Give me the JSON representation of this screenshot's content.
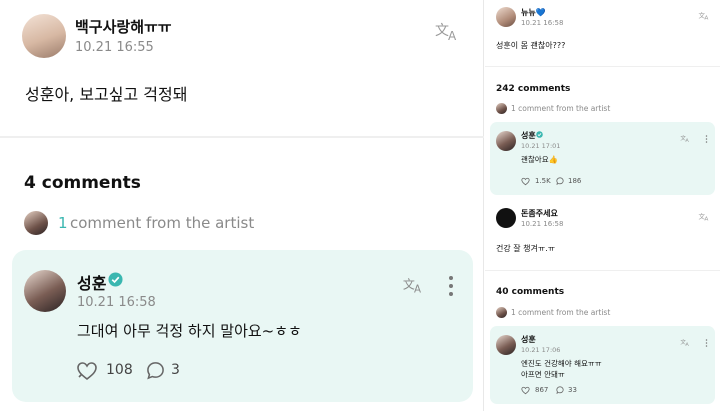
{
  "left": {
    "post": {
      "username": "백구사랑해ㅠㅠ",
      "time": "10.21 16:55",
      "body": "성훈아, 보고싶고 걱정돼"
    },
    "comments_title": "4 comments",
    "artist_count": "1",
    "artist_label": "comment from the artist",
    "comment": {
      "name": "성훈",
      "time": "10.21 16:58",
      "text": "그대여 아무 걱정 하지 말아요~ㅎㅎ",
      "likes": "108",
      "replies": "3"
    }
  },
  "right": {
    "post1": {
      "username": "뉴뉴💙",
      "time": "10.21 16:58",
      "body": "성훈이 몸 괜찮아???"
    },
    "comments1_title": "242 comments",
    "artist_label1": "1 comment from the artist",
    "card1": {
      "name": "성훈",
      "time": "10.21 17:01",
      "text": "괜찮아요👍",
      "likes": "1.5K",
      "replies": "186"
    },
    "post2": {
      "username": "돈좀주세요",
      "time": "10.21 16:58",
      "body": "건강 잘 챙겨ㅠ.ㅠ"
    },
    "comments2_title": "40 comments",
    "artist_label2": "1 comment from the artist",
    "card2": {
      "name": "성훈",
      "time": "10.21 17:06",
      "text_line1": "엔진도 건강해야 해요ㅠㅠ",
      "text_line2": "아프면 안돼ㅠ",
      "likes": "867",
      "replies": "33"
    }
  },
  "colors": {
    "accent": "#3ab7b0",
    "card_bg": "#e9f7f4",
    "verified": "#3ab7b0"
  },
  "icons": [
    "translate-icon",
    "verified-icon",
    "more-icon",
    "heart-icon",
    "reply-icon"
  ]
}
